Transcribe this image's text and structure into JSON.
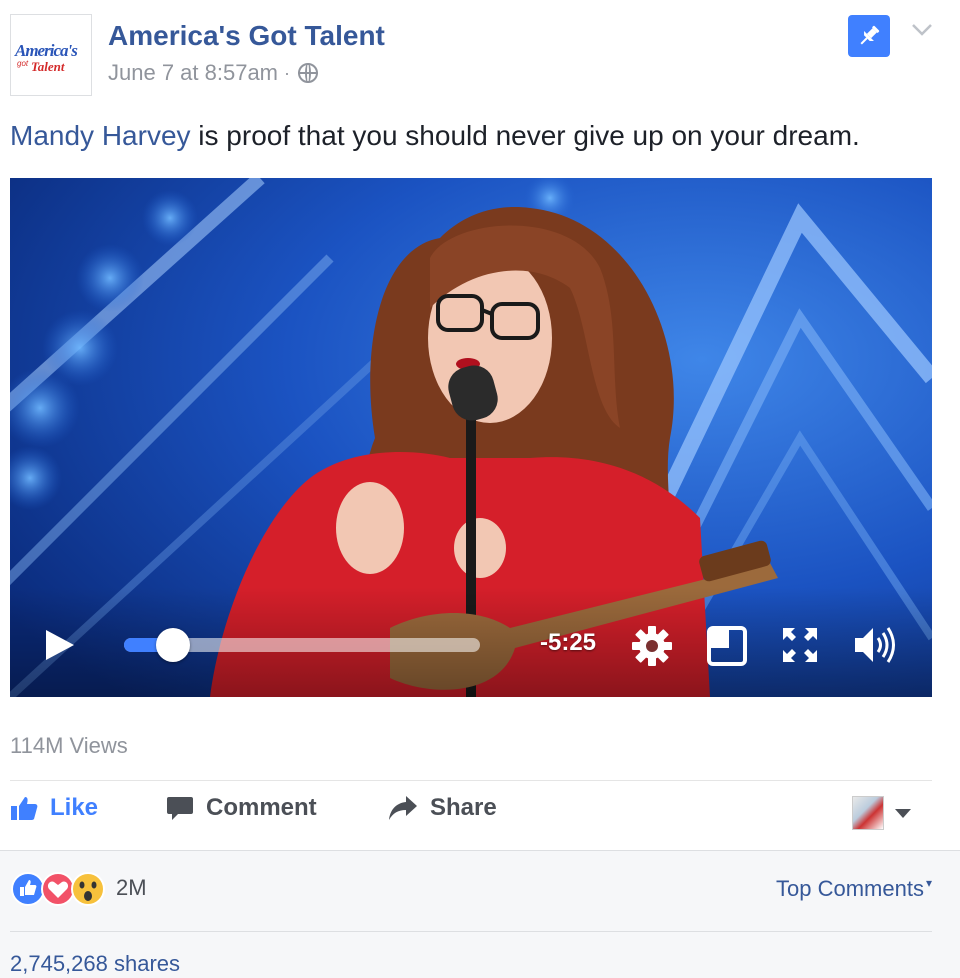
{
  "post": {
    "page_name": "America's Got Talent",
    "avatar": {
      "logo_line1": "America's",
      "logo_got": "got",
      "logo_line2": "Talent"
    },
    "timestamp": "June 7 at 8:57am",
    "meta_separator": "·",
    "privacy_icon": "globe-icon",
    "message_mention": "Mandy Harvey",
    "message_text": " is proof that you should never give up on your dream."
  },
  "video": {
    "time_remaining": "-5:25",
    "progress": 0.09,
    "icons": [
      "play-icon",
      "gear-icon",
      "picture-in-picture-icon",
      "fullscreen-icon",
      "volume-icon"
    ]
  },
  "stats": {
    "views": "114M Views",
    "reaction_count": "2M",
    "shares": "2,745,268 shares"
  },
  "actions": {
    "like": "Like",
    "comment": "Comment",
    "share": "Share"
  },
  "comments": {
    "sort_label": "Top Comments",
    "caret": "▾"
  },
  "colors": {
    "link": "#365899",
    "accent": "#4080ff",
    "muted": "#90949c"
  }
}
